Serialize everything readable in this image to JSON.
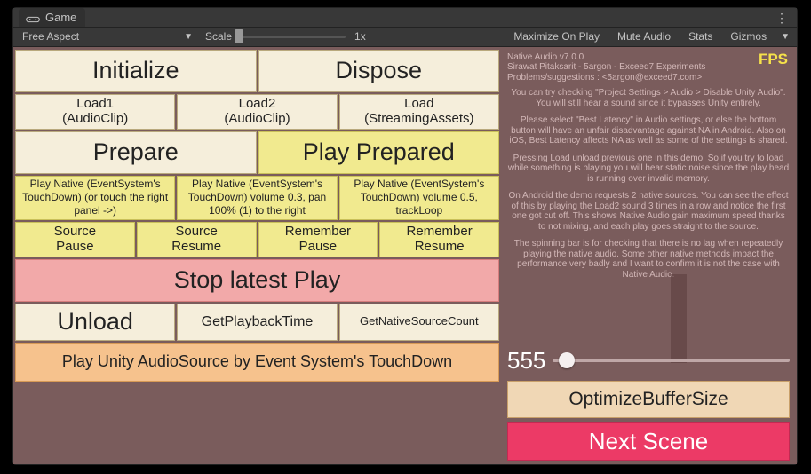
{
  "tab": {
    "label": "Game"
  },
  "toolbar": {
    "aspect": "Free Aspect",
    "scale_label": "Scale",
    "scale_value": "1x",
    "maximize": "Maximize On Play",
    "mute": "Mute Audio",
    "stats": "Stats",
    "gizmos": "Gizmos"
  },
  "left": {
    "row1": [
      "Initialize",
      "Dispose"
    ],
    "row2": [
      {
        "line1": "Load1",
        "line2": "(AudioClip)"
      },
      {
        "line1": "Load2",
        "line2": "(AudioClip)"
      },
      {
        "line1": "Load",
        "line2": "(StreamingAssets)"
      }
    ],
    "row3": [
      "Prepare",
      "Play Prepared"
    ],
    "row4": [
      "Play Native (EventSystem's TouchDown) (or touch the right panel ->)",
      "Play Native (EventSystem's TouchDown)  volume 0.3, pan 100% (1) to the right",
      "Play Native (EventSystem's TouchDown)  volume 0.5, trackLoop"
    ],
    "row5": [
      {
        "line1": "Source",
        "line2": "Pause"
      },
      {
        "line1": "Source",
        "line2": "Resume"
      },
      {
        "line1": "Remember",
        "line2": "Pause"
      },
      {
        "line1": "Remember",
        "line2": "Resume"
      }
    ],
    "stop": "Stop latest Play",
    "row7": [
      "Unload",
      "GetPlaybackTime",
      "GetNativeSourceCount"
    ],
    "row8": "Play Unity AudioSource by Event System's TouchDown"
  },
  "right": {
    "fps_label": "FPS",
    "header_line1": "Native Audio v7.0.0",
    "header_line2": "Sirawat Pitaksarit - 5argon - Exceed7 Experiments",
    "header_line3": "Problems/suggestions : <5argon@exceed7.com>",
    "p1": "You can try checking \"Project Settings > Audio > Disable Unity Audio\". You will still hear a sound since it bypasses Unity entirely.",
    "p2": "Please select \"Best Latency\" in Audio settings, or else the bottom button will have an unfair disadvantage against NA in Android. Also on iOS, Best Latency affects NA as well as some of the settings is shared.",
    "p3": "Pressing Load unload previous one in this demo. So if you try to load while something is playing you will hear static noise since the play head is running over invalid memory.",
    "p4": "On Android the demo requests 2 native sources. You can see the effect of this by playing the Load2 sound 3 times in a row and notice the first one got cut off. This shows Native Audio gain maximum speed thanks to not mixing, and each play goes straight to the source.",
    "p5": "The spinning bar is for checking that there is no lag when repeatedly playing the native audio. Some other native methods impact the performance very badly and I want to confirm it is not the case with Native Audio.",
    "slider_value": "555",
    "optimize": "OptimizeBufferSize",
    "next": "Next Scene"
  }
}
